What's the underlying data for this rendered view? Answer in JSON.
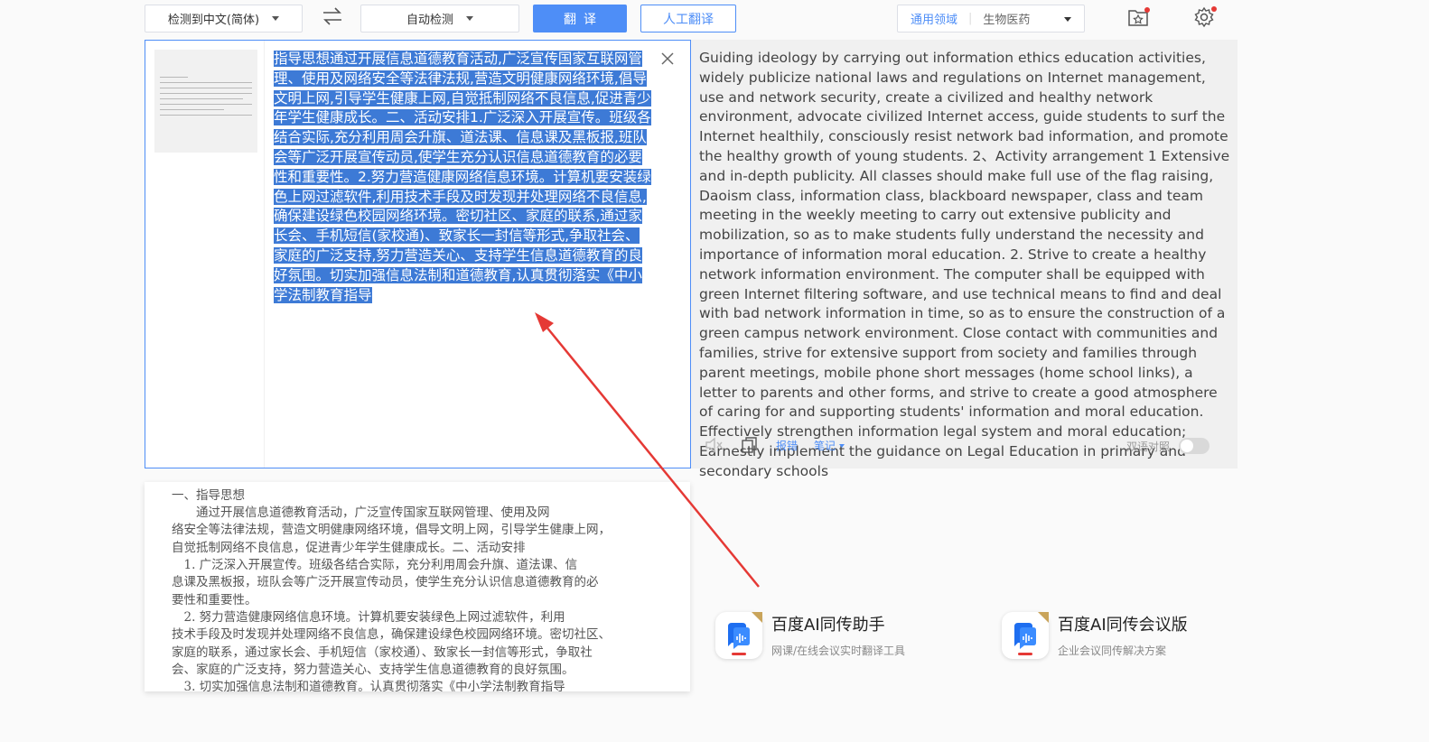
{
  "toolbar": {
    "source_lang": "检测到中文(简体)",
    "target_lang": "自动检测",
    "translate_label": "翻译",
    "human_translate_label": "人工翻译",
    "domain_label": "通用领域",
    "domain_value": "生物医药"
  },
  "source": {
    "text": "指导思想通过开展信息道德教育活动,广泛宣传国家互联网管理、使用及网络安全等法律法规,营造文明健康网络环境,倡导文明上网,引导学生健康上网,自觉抵制网络不良信息,促进青少年学生健康成长。二、活动安排1.广泛深入开展宣传。班级各结合实际,充分利用周会升旗、道法课、信息课及黑板报,班队会等广泛开展宣传动员,使学生充分认识信息道德教育的必要性和重要性。2.努力营造健康网络信息环境。计算机要安装绿色上网过滤软件,利用技术手段及时发现并处理网络不良信息,确保建设绿色校园网络环境。密切社区、家庭的联系,通过家长会、手机短信(家校通)、致家长一封信等形式,争取社会、家庭的广泛支持,努力营造关心、支持学生信息道德教育的良好氛围。切实加强信息法制和道德教育,认真贯彻落实《中小学法制教育指导"
  },
  "target": {
    "text": "Guiding ideology by carrying out information ethics education activities, widely publicize national laws and regulations on Internet management, use and network security, create a civilized and healthy network environment, advocate civilized Internet access, guide students to surf the Internet healthily, consciously resist network bad information, and promote the healthy growth of young students. 2、Activity arrangement 1 Extensive and in-depth publicity. All classes should make full use of the flag raising, Daoism class, information class, blackboard newspaper, class and team meeting in the weekly meeting to carry out extensive publicity and mobilization, so as to make students fully understand the necessity and importance of information moral education. 2. Strive to create a healthy network information environment. The computer shall be equipped with green Internet filtering software, and use technical means to find and deal with bad network information in time, so as to ensure the construction of a green campus network environment. Close contact with communities and families, strive for extensive support from society and families through parent meetings, mobile phone short messages (home school links), a letter to parents and other forms, and strive to create a good atmosphere of caring for and supporting students' information and moral education. Effectively strengthen information legal system and moral education; Earnestly implement the guidance on Legal Education in primary and secondary schools",
    "report_label": "报错",
    "notes_label": "笔记",
    "bilingual_label": "双语对照"
  },
  "document_lines": [
    "一、指导思想",
    "　　通过开展信息道德教育活动，广泛宣传国家互联网管理、使用及网",
    "络安全等法律法规，营造文明健康网络环境，倡导文明上网，引导学生健康上网，",
    "自觉抵制网络不良信息，促进青少年学生健康成长。二、活动安排",
    "　1. 广泛深入开展宣传。班级各结合实际，充分利用周会升旗、道法课、信",
    "息课及黑板报，班队会等广泛开展宣传动员，使学生充分认识信息道德教育的必",
    "要性和重要性。",
    "　2. 努力营造健康网络信息环境。计算机要安装绿色上网过滤软件，利用",
    "技术手段及时发现并处理网络不良信息，确保建设绿色校园网络环境。密切社区、",
    "家庭的联系，通过家长会、手机短信（家校通）、致家长一封信等形式，争取社",
    "会、家庭的广泛支持，努力营造关心、支持学生信息道德教育的良好氛围。",
    "　3. 切实加强信息法制和道德教育。认真贯彻落实《中小学法制教育指导"
  ],
  "promos": [
    {
      "title": "百度AI同传助手",
      "subtitle": "网课/在线会议实时翻译工具"
    },
    {
      "title": "百度AI同传会议版",
      "subtitle": "企业会议同传解决方案"
    }
  ],
  "colors": {
    "accent": "#4e8ef7",
    "highlight": "#3d7ad6",
    "arrow": "#e53935"
  }
}
